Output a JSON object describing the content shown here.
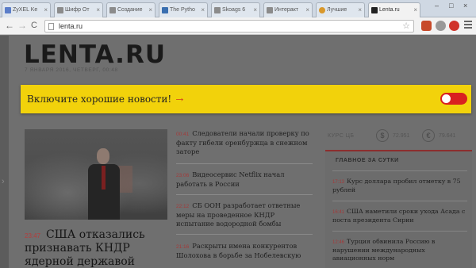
{
  "browser": {
    "tabs": [
      {
        "label": "ZyXEL Ke",
        "fav": "#5b7ec9"
      },
      {
        "label": "Шифр От",
        "fav": "#8b8b8b"
      },
      {
        "label": "Создание",
        "fav": "#8b8b8b"
      },
      {
        "label": "The Pytho",
        "fav": "#3a6fb0"
      },
      {
        "label": "Skoags 6",
        "fav": "#8b8b8b"
      },
      {
        "label": "Интеракт",
        "fav": "#8b8b8b"
      },
      {
        "label": "Лучшие",
        "fav": "#d9982b"
      },
      {
        "label": "Lenta.ru",
        "fav": "#222222"
      }
    ],
    "url": "lenta.ru",
    "back_glyph": "←",
    "forward_glyph": "→",
    "reload_glyph": "C",
    "close_glyph": "×",
    "window_controls": {
      "minimize": "–",
      "maximize": "□",
      "close": "×"
    }
  },
  "site": {
    "logo": "LENTA.RU",
    "dateline": "7 ЯНВАРЯ 2016, ЧЕТВЕРГ, 00:48"
  },
  "banner": {
    "text": "Включите хорошие новости!",
    "arrow": "→",
    "toggle_state": "off"
  },
  "lead": {
    "time": "23:47",
    "title": "США отказались признавать КНДР ядерной державой"
  },
  "feed": [
    {
      "time": "00:41",
      "title": "Следователи начали проверку по факту гибели оренбуржца в снежном заторе"
    },
    {
      "time": "23:06",
      "title": "Видеосервис Netflix начал работать в России"
    },
    {
      "time": "22:12",
      "title": "СБ ООН разработает ответные меры на проведенное КНДР испытание водородной бомбы"
    },
    {
      "time": "21:16",
      "title": "Раскрыты имена конкурентов Шолохова в борьбе за Нобелевскую"
    }
  ],
  "rates": {
    "label": "КУРС ЦБ",
    "usd_symbol": "$",
    "usd_value": "72.951",
    "eur_symbol": "€",
    "eur_value": "79.641"
  },
  "sidebar": {
    "header": "ГЛАВНОЕ ЗА СУТКИ",
    "items": [
      {
        "time": "17:13",
        "title": "Курс доллара пробил отметку в 75 рублей"
      },
      {
        "time": "16:41",
        "title": "США наметили сроки ухода Асада с поста президента Сирии"
      },
      {
        "time": "12:46",
        "title": "Турция обвинила Россию в нарушении международных авиационных норм"
      }
    ]
  }
}
